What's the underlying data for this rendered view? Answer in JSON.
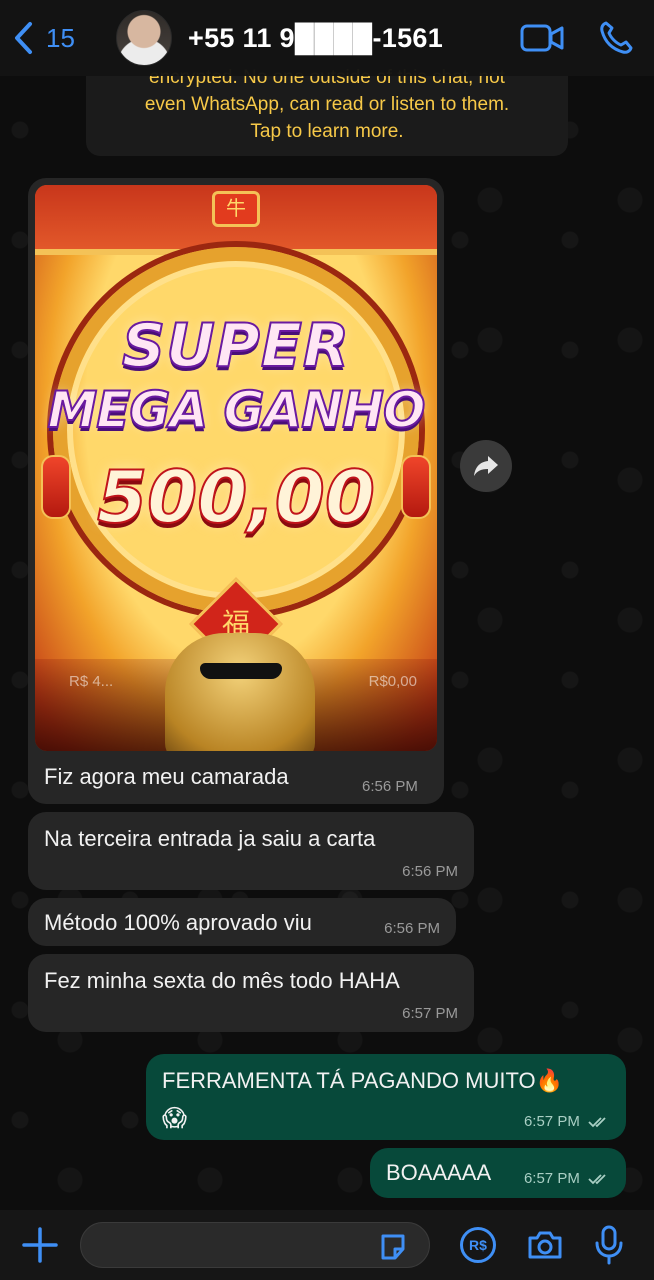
{
  "header": {
    "back_count": "15",
    "contact_name": "+55 11 9████-1561"
  },
  "encryption_notice": {
    "line1": "encrypted. No one outside of this chat, not",
    "line2": "even WhatsApp, can read or listen to them.",
    "line3": "Tap to learn more."
  },
  "messages": [
    {
      "direction": "incoming",
      "type": "image",
      "image": {
        "line1": "SUPER",
        "line2": "MEGA GANHO",
        "amount": "500,00",
        "badge_top": "牛",
        "fu_char": "福",
        "balance_left": "R$ 4...",
        "balance_right": "R$0,00"
      },
      "caption": "Fiz agora meu camarada",
      "time": "6:56 PM"
    },
    {
      "direction": "incoming",
      "text": "Na terceira entrada ja saiu a carta",
      "time": "6:56 PM"
    },
    {
      "direction": "incoming",
      "text": "Método 100% aprovado viu",
      "time": "6:56 PM"
    },
    {
      "direction": "incoming",
      "text": "Fez minha sexta do mês todo HAHA",
      "time": "6:57 PM"
    },
    {
      "direction": "outgoing",
      "text": "FERRAMENTA TÁ PAGANDO MUITO🔥",
      "emoji": "😱",
      "time": "6:57 PM",
      "status": "read"
    },
    {
      "direction": "outgoing",
      "text": "BOAAAAA",
      "time": "6:57 PM",
      "status": "read"
    }
  ],
  "input_bar": {
    "placeholder": "",
    "payment_label": "R$"
  },
  "colors": {
    "accent": "#3f8ff5",
    "outgoing_bubble": "#07493a",
    "incoming_bubble": "#262626",
    "encryption_text": "#f7c948"
  },
  "icons": [
    "chevron-left-icon",
    "video-call-icon",
    "phone-icon",
    "forward-icon",
    "plus-icon",
    "sticker-icon",
    "payment-icon",
    "camera-icon",
    "microphone-icon",
    "double-check-icon"
  ]
}
